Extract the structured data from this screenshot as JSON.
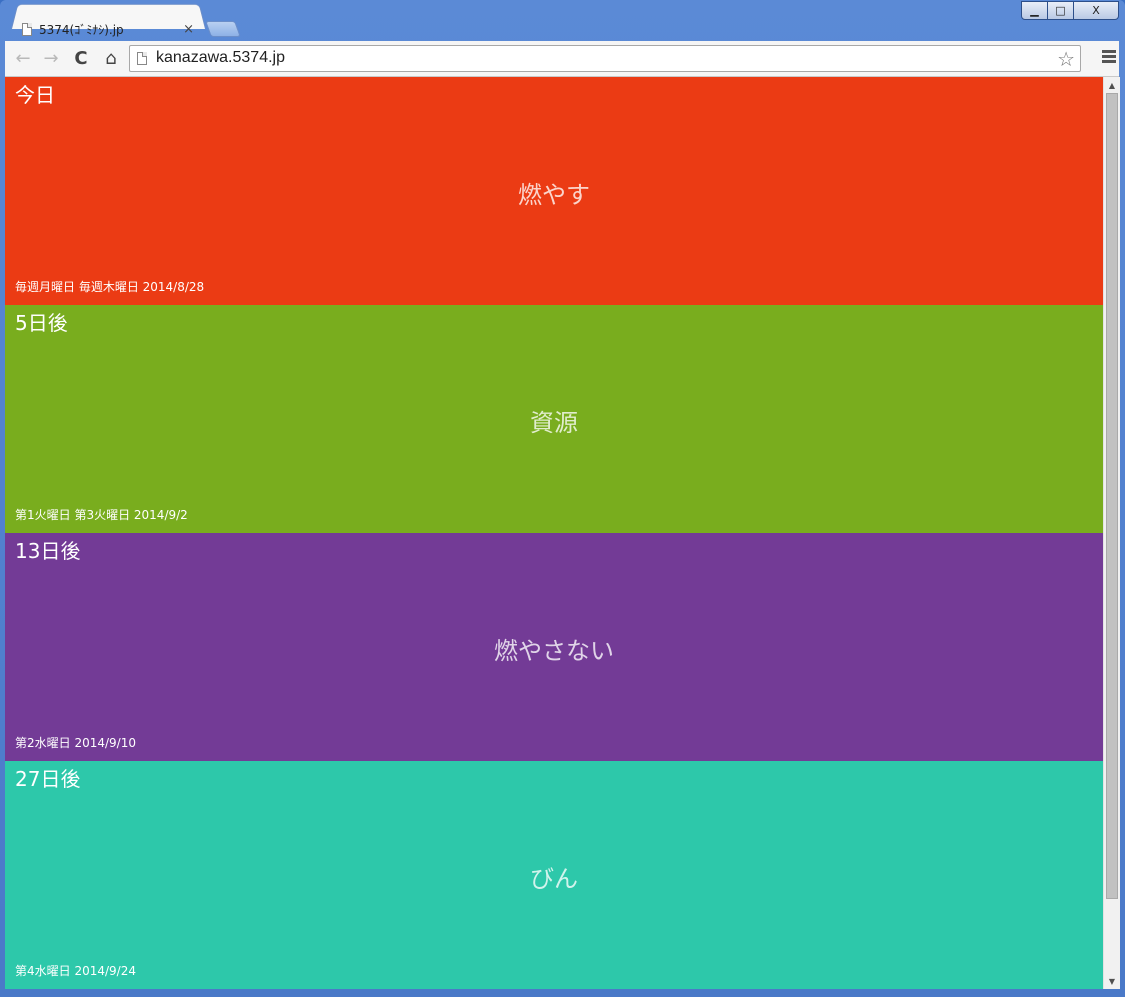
{
  "window": {
    "minimize": "▁",
    "maximize": "□",
    "close": "X"
  },
  "tab": {
    "title": "5374(ｺﾞﾐﾅｼ).jp",
    "close": "×"
  },
  "toolbar": {
    "back_icon": "←",
    "forward_icon": "→",
    "reload_icon": "C",
    "home_icon": "⌂",
    "url": "kanazawa.5374.jp",
    "bookmark_icon": "☆"
  },
  "cards": [
    {
      "days": "今日",
      "kind": "燃やす",
      "schedule": "毎週月曜日 毎週木曜日 2014/8/28",
      "color": "#eb3b14"
    },
    {
      "days": "5日後",
      "kind": "資源",
      "schedule": "第1火曜日 第3火曜日 2014/9/2",
      "color": "#79ad1e"
    },
    {
      "days": "13日後",
      "kind": "燃やさない",
      "schedule": "第2水曜日 2014/9/10",
      "color": "#733b96"
    },
    {
      "days": "27日後",
      "kind": "びん",
      "schedule": "第4水曜日 2014/9/24",
      "color": "#2dc8aa"
    }
  ],
  "scrollbar": {
    "up": "▲",
    "down": "▼"
  }
}
